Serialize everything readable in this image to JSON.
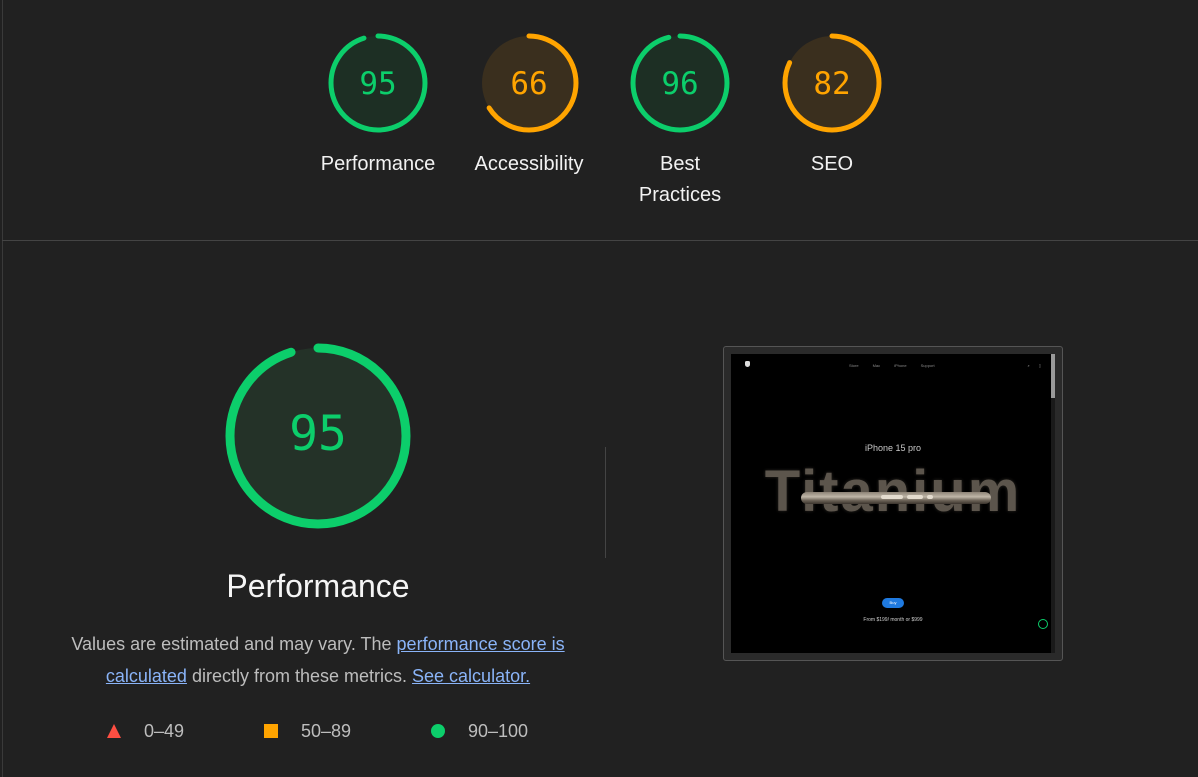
{
  "categories": [
    {
      "label": "Performance",
      "score": 95,
      "rating": "pass"
    },
    {
      "label": "Accessibility",
      "score": 66,
      "rating": "average"
    },
    {
      "label": "Best Practices",
      "score": 96,
      "rating": "pass"
    },
    {
      "label": "SEO",
      "score": 82,
      "rating": "average"
    }
  ],
  "performance": {
    "score": 95,
    "title": "Performance",
    "desc_prefix": "Values are estimated and may vary. The ",
    "desc_link1": "performance score is calculated",
    "desc_middle": " directly from these metrics. ",
    "desc_link2": "See calculator."
  },
  "legend": [
    {
      "shape": "triangle",
      "range": "0–49",
      "color": "#ff4e42"
    },
    {
      "shape": "square",
      "range": "50–89",
      "color": "#ffa400"
    },
    {
      "shape": "circle",
      "range": "90–100",
      "color": "#0cce6b"
    }
  ],
  "colors": {
    "pass": "#0cce6b",
    "pass_bg": "#1d2f24",
    "average": "#ffa400",
    "average_bg": "#3a2f1e",
    "fail": "#ff4e42"
  },
  "screenshot": {
    "nav_links": [
      "Store",
      "Mac",
      "iPhone",
      "Support"
    ],
    "icons": [
      "search-icon",
      "bag-icon"
    ],
    "product": "iPhone 15 pro",
    "headline": "Titanium",
    "buy": "Buy",
    "price": "From $199/ month or $999"
  }
}
